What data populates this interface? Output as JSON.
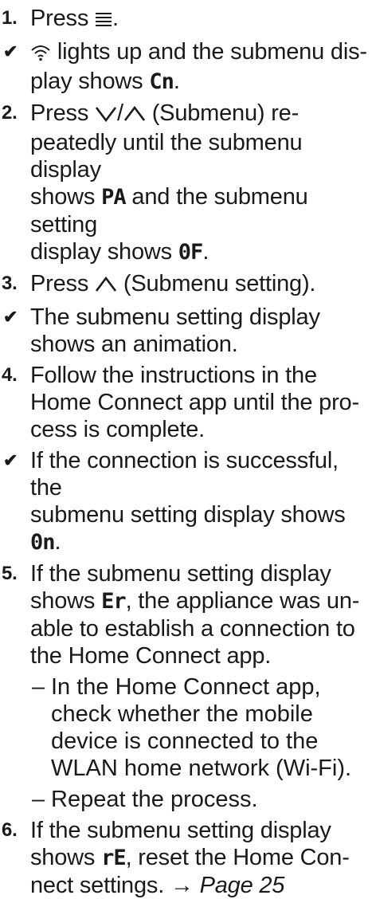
{
  "steps": {
    "s1": {
      "num": "1.",
      "pre": "Press "
    },
    "r1": {
      "check": "✔",
      "post_icon": " lights up and the submenu dis-",
      "l2": "play shows ",
      "code": "Cn"
    },
    "s2": {
      "num": "2.",
      "pre": "Press ",
      "mid": " (Submenu) re-",
      "l2": "peatedly until the submenu display",
      "l3a": "shows ",
      "code1": "PA",
      "l3b": " and the submenu setting",
      "l4a": "display shows ",
      "code2": "0F"
    },
    "s3": {
      "num": "3.",
      "pre": "Press ",
      "post": " (Submenu setting)."
    },
    "r3": {
      "check": "✔",
      "l1": "The submenu setting display",
      "l2": "shows an animation."
    },
    "s4": {
      "num": "4.",
      "l1": "Follow the instructions in the",
      "l2": "Home Connect app until the pro-",
      "l3": "cess is complete."
    },
    "r4": {
      "check": "✔",
      "l1": "If the connection is successful, the",
      "l2a": "submenu setting display shows ",
      "code": "0n"
    },
    "s5": {
      "num": "5.",
      "l1": "If the submenu setting display",
      "l2a": "shows ",
      "code": "Er",
      "l2b": ", the appliance was un-",
      "l3": "able to establish a connection to",
      "l4": "the Home Connect app."
    },
    "sub1": {
      "dash": "–",
      "l1": "In the Home Connect app,",
      "l2": "check whether the mobile",
      "l3": "device is connected to the",
      "l4": "WLAN home network (Wi-Fi)."
    },
    "sub2": {
      "dash": "–",
      "l1": "Repeat the process."
    },
    "s6": {
      "num": "6.",
      "l1": "If the submenu setting display",
      "l2a": "shows ",
      "code": "rE",
      "l2b": ", reset the Home Con-",
      "l3a": "nect settings. → ",
      "page": "Page 25"
    }
  },
  "icons": [
    "menu-icon",
    "wifi-icon",
    "down-arrow-icon",
    "up-arrow-icon"
  ]
}
